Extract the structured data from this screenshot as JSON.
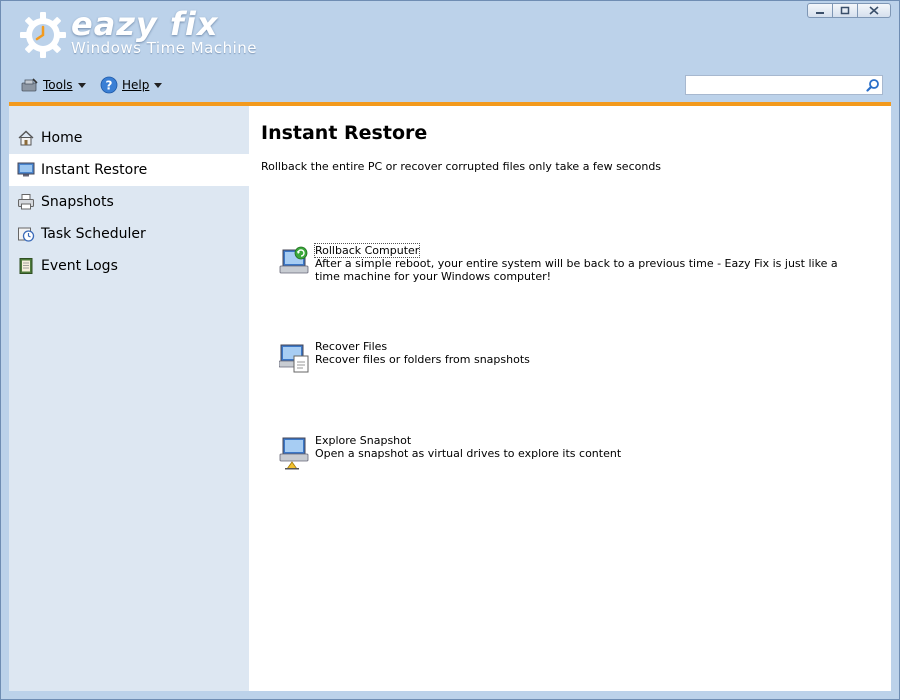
{
  "brand": {
    "name": "eazy fix",
    "subtitle": "Windows Time Machine"
  },
  "toolbar": {
    "tools_label": "Tools",
    "help_label": "Help",
    "search_placeholder": ""
  },
  "sidebar": {
    "items": [
      {
        "label": "Home",
        "icon": "house-icon"
      },
      {
        "label": "Instant Restore",
        "icon": "monitor-icon",
        "active": true
      },
      {
        "label": "Snapshots",
        "icon": "printer-icon"
      },
      {
        "label": "Task Scheduler",
        "icon": "clock-icon"
      },
      {
        "label": "Event Logs",
        "icon": "log-book-icon"
      }
    ]
  },
  "main": {
    "title": "Instant Restore",
    "description": "Rollback the entire PC or recover corrupted files only take a few seconds",
    "actions": [
      {
        "title": "Rollback Computer",
        "description": "After a simple reboot, your entire system will be back to a previous time - Eazy Fix is just like a time machine for your Windows computer!",
        "icon": "rollback-computer-icon"
      },
      {
        "title": "Recover Files",
        "description": "Recover files or folders from snapshots",
        "icon": "recover-files-icon"
      },
      {
        "title": "Explore Snapshot",
        "description": "Open a snapshot as virtual drives to explore its content",
        "icon": "explore-snapshot-icon"
      }
    ]
  },
  "colors": {
    "accent": "#f39a1d",
    "chrome": "#bcd2ea",
    "sidebar": "#dde7f2"
  }
}
